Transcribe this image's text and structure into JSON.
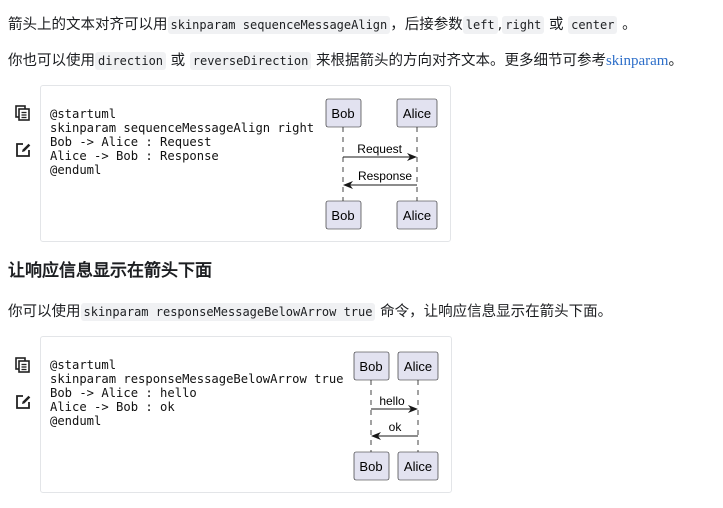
{
  "para1": {
    "t1": "箭头上的文本对齐可以用",
    "c1": "skinparam sequenceMessageAlign",
    "t2": "，后接参数",
    "c2": "left",
    "t3": ",",
    "c3": "right",
    "t4": "或",
    "c4": "center",
    "t5": "。"
  },
  "para2": {
    "t1": "你也可以使用",
    "c1": "direction",
    "t2": "或",
    "c2": "reverseDirection",
    "t3": "来根据箭头的方向对齐文本。更多细节可参考",
    "link": "skinparam",
    "t4": "。"
  },
  "example1": {
    "code": "@startuml\nskinparam sequenceMessageAlign right\nBob -> Alice : Request\nAlice -> Bob : Response\n@enduml",
    "participants": [
      "Bob",
      "Alice"
    ],
    "messages": [
      {
        "from": "Bob",
        "to": "Alice",
        "label": "Request"
      },
      {
        "from": "Alice",
        "to": "Bob",
        "label": "Response"
      }
    ]
  },
  "heading": "让响应信息显示在箭头下面",
  "para3": {
    "t1": "你可以使用",
    "c1": "skinparam responseMessageBelowArrow true",
    "t2": "命令，让响应信息显示在箭头下面。"
  },
  "example2": {
    "code": "@startuml\nskinparam responseMessageBelowArrow true\nBob -> Alice : hello\nAlice -> Bob : ok\n@enduml",
    "participants": [
      "Bob",
      "Alice"
    ],
    "messages": [
      {
        "from": "Bob",
        "to": "Alice",
        "label": "hello"
      },
      {
        "from": "Alice",
        "to": "Bob",
        "label": "ok"
      }
    ]
  },
  "icons": {
    "copy": "copy-icon",
    "edit": "edit-icon"
  },
  "colors": {
    "link": "#2e6fc9",
    "participant_fill": "#e2e2f0",
    "participant_border": "#181818",
    "code_bg": "#f0f1f3"
  }
}
